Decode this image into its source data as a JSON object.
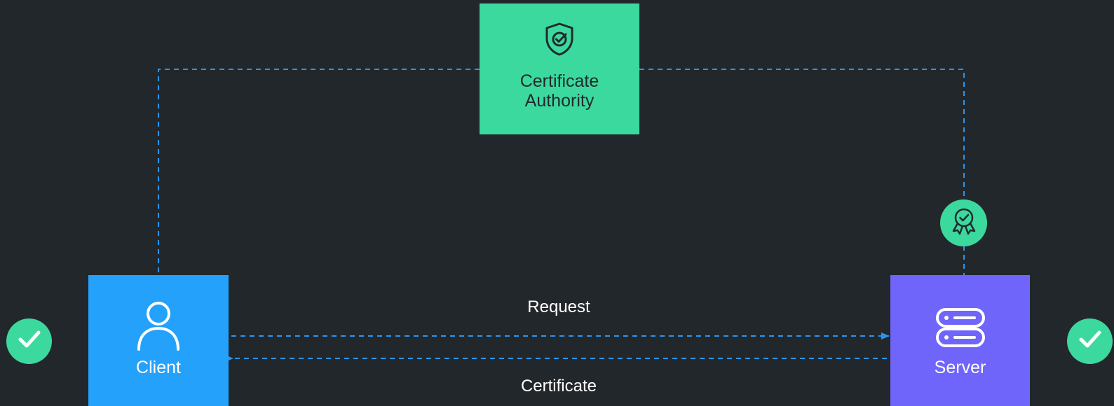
{
  "diagram": {
    "nodes": {
      "certificate_authority": {
        "label_line1": "Certificate",
        "label_line2": "Authority",
        "icon": "shield-check-icon",
        "color": "#3cd99f"
      },
      "client": {
        "label": "Client",
        "icon": "user-icon",
        "color": "#24a1fb"
      },
      "server": {
        "label": "Server",
        "icon": "server-icon",
        "color": "#7065fa"
      }
    },
    "edges": {
      "request_label": "Request",
      "certificate_label": "Certificate"
    },
    "badges": {
      "certificate_badge_icon": "award-ribbon-icon",
      "client_check_icon": "check-icon",
      "server_check_icon": "check-icon"
    },
    "colors": {
      "background": "#22272b",
      "connector": "#2a95f0",
      "badge": "#3cd99f"
    }
  }
}
